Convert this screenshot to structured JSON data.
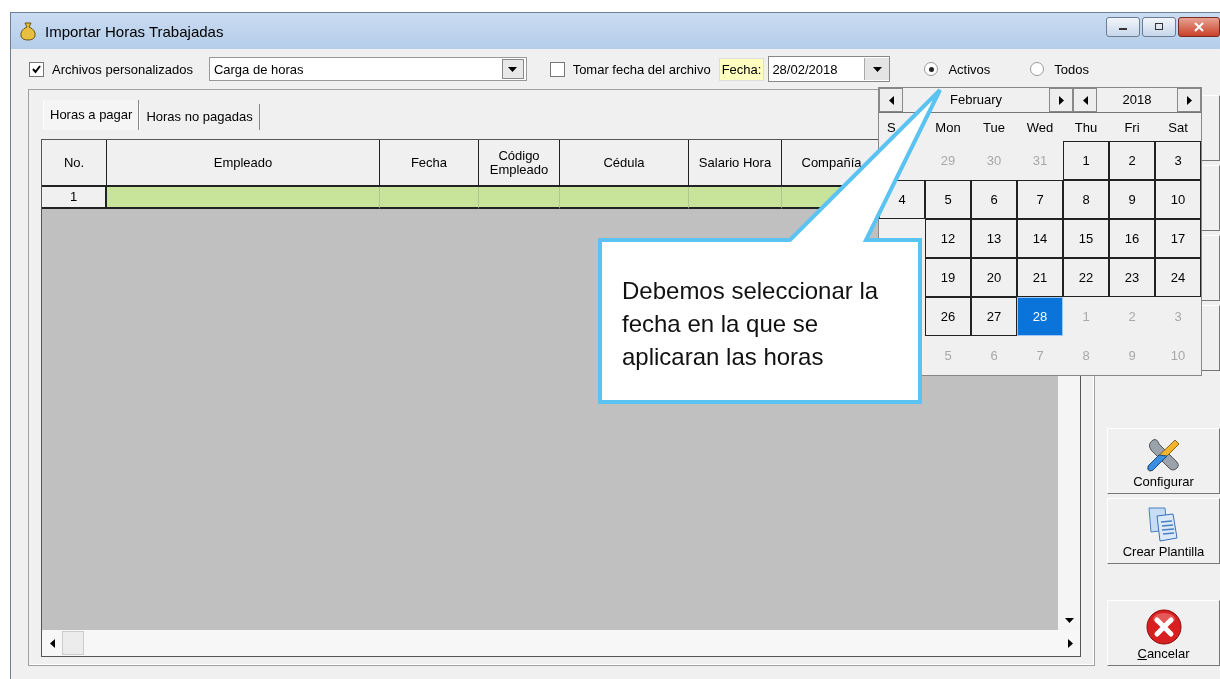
{
  "window": {
    "title": "Importar Horas Trabajadas"
  },
  "toolbar": {
    "custom_files": {
      "label": "Archivos personalizados",
      "checked": true
    },
    "file_type": {
      "value": "Carga de horas"
    },
    "take_date": {
      "label": "Tomar fecha del archivo",
      "checked": false
    },
    "date_label": "Fecha:",
    "date": {
      "value": "28/02/2018"
    },
    "filter": [
      {
        "label": "Activos",
        "selected": true
      },
      {
        "label": "Todos",
        "selected": false
      }
    ]
  },
  "tabs": [
    {
      "label": "Horas a pagar",
      "selected": true
    },
    {
      "label": "Horas no pagadas",
      "selected": false
    }
  ],
  "table": {
    "columns": [
      "No.",
      "Empleado",
      "Fecha",
      "Código Empleado",
      "Cédula",
      "Salario Hora",
      "Compañía"
    ],
    "rows": [
      {
        "number": "1"
      }
    ]
  },
  "calendar": {
    "month": "February",
    "year": "2018",
    "weekdays": [
      "S",
      "Mon",
      "Tue",
      "Wed",
      "Thu",
      "Fri",
      "Sat"
    ],
    "weeks": [
      [
        {
          "kind": "hidden"
        },
        {
          "kind": "other",
          "day": "29"
        },
        {
          "kind": "other",
          "day": "30"
        },
        {
          "kind": "other",
          "day": "31"
        },
        {
          "kind": "day",
          "day": "1"
        },
        {
          "kind": "day",
          "day": "2"
        },
        {
          "kind": "day",
          "day": "3"
        }
      ],
      [
        {
          "kind": "day",
          "day": "4"
        },
        {
          "kind": "day",
          "day": "5"
        },
        {
          "kind": "day",
          "day": "6"
        },
        {
          "kind": "day",
          "day": "7"
        },
        {
          "kind": "day",
          "day": "8"
        },
        {
          "kind": "day",
          "day": "9"
        },
        {
          "kind": "day",
          "day": "10"
        }
      ],
      [
        {
          "kind": "hidden"
        },
        {
          "kind": "day",
          "day": "12"
        },
        {
          "kind": "day",
          "day": "13"
        },
        {
          "kind": "day",
          "day": "14"
        },
        {
          "kind": "day",
          "day": "15"
        },
        {
          "kind": "day",
          "day": "16"
        },
        {
          "kind": "day",
          "day": "17"
        }
      ],
      [
        {
          "kind": "hidden"
        },
        {
          "kind": "day",
          "day": "19"
        },
        {
          "kind": "day",
          "day": "20"
        },
        {
          "kind": "day",
          "day": "21"
        },
        {
          "kind": "day",
          "day": "22"
        },
        {
          "kind": "day",
          "day": "23"
        },
        {
          "kind": "day",
          "day": "24"
        }
      ],
      [
        {
          "kind": "hidden"
        },
        {
          "kind": "day",
          "day": "26"
        },
        {
          "kind": "day",
          "day": "27"
        },
        {
          "kind": "selected",
          "day": "28"
        },
        {
          "kind": "other",
          "day": "1"
        },
        {
          "kind": "other",
          "day": "2"
        },
        {
          "kind": "other",
          "day": "3"
        }
      ],
      [
        {
          "kind": "hidden"
        },
        {
          "kind": "other",
          "day": "5"
        },
        {
          "kind": "other",
          "day": "6"
        },
        {
          "kind": "other",
          "day": "7"
        },
        {
          "kind": "other",
          "day": "8"
        },
        {
          "kind": "other",
          "day": "9"
        },
        {
          "kind": "other",
          "day": "10"
        }
      ]
    ]
  },
  "callout": {
    "text": "Debemos seleccionar la fecha en la que se aplicaran las horas"
  },
  "side_buttons": [
    {
      "kind": "hidden"
    },
    {
      "kind": "hidden"
    },
    {
      "kind": "hidden"
    },
    {
      "kind": "hidden"
    },
    {
      "kind": "configure",
      "label": "Configurar",
      "access_key": false
    },
    {
      "kind": "template",
      "label": "Crear Plantilla",
      "access_key": false
    },
    {
      "kind": "cancel",
      "label": "Cancelar",
      "access_key": true
    }
  ]
}
